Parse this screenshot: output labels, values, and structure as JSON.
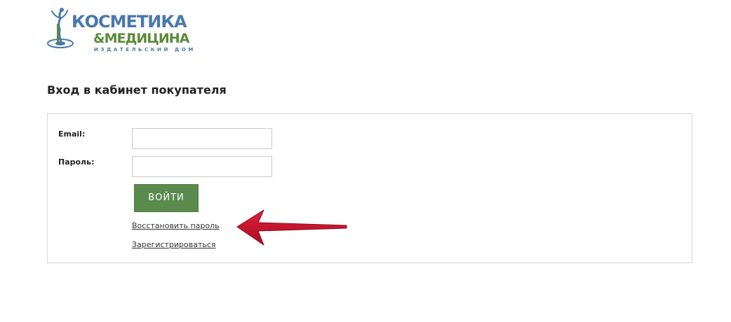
{
  "logo": {
    "line1": "КОСМЕТИКА",
    "line2": "&МЕДИЦИНА",
    "line3": "ИЗДАТЕЛЬСКИЙ ДОМ",
    "colors": {
      "blue": "#4a78ad",
      "green": "#5c8a3a"
    }
  },
  "page": {
    "title": "Вход в кабинет покупателя"
  },
  "form": {
    "email_label": "Email:",
    "email_value": "",
    "password_label": "Пароль:",
    "password_value": "",
    "submit_label": "ВОЙТИ",
    "restore_link": "Восстановить пароль",
    "register_link": "Зарегистрироваться"
  },
  "colors": {
    "button_bg": "#5a8a4e",
    "panel_border": "#d6d6d6",
    "arrow": "#c8102e"
  },
  "annotation": {
    "icon": "red-arrow-icon"
  }
}
